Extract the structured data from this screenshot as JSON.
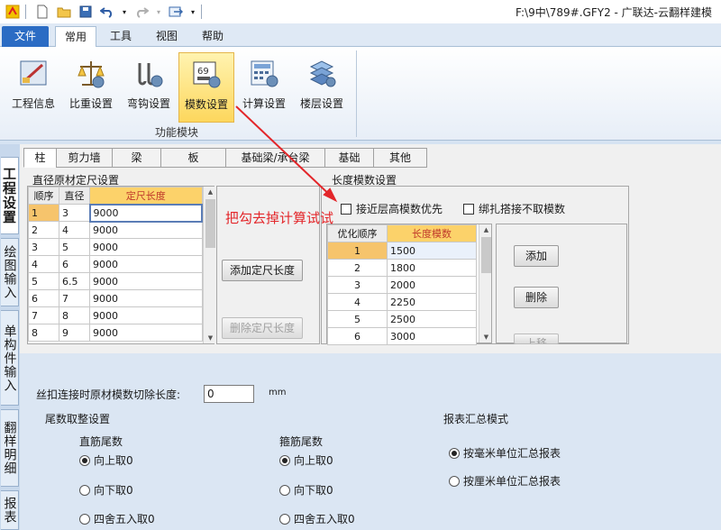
{
  "window": {
    "title": "F:\\9中\\789#.GFY2 - 广联达-云翻样建模"
  },
  "quick_access": [
    "new-file-icon",
    "open-folder-icon",
    "save-icon",
    "undo-icon",
    "redo-icon",
    "export-icon"
  ],
  "menu": {
    "file": "文件",
    "tabs": [
      "常用",
      "工具",
      "视图",
      "帮助"
    ],
    "active": "常用"
  },
  "ribbon": {
    "buttons": [
      {
        "label": "工程信息",
        "icon": "project-info-icon"
      },
      {
        "label": "比重设置",
        "icon": "scale-icon"
      },
      {
        "label": "弯钩设置",
        "icon": "hook-icon"
      },
      {
        "label": "模数设置",
        "icon": "modulus-icon"
      },
      {
        "label": "计算设置",
        "icon": "calculator-icon"
      },
      {
        "label": "楼层设置",
        "icon": "floor-icon"
      }
    ],
    "group_label": "功能模块"
  },
  "side_tabs": [
    "工程设置",
    "绘图输入",
    "单构件输入",
    "翻样明细",
    "报表"
  ],
  "sub_tabs": [
    "柱",
    "剪力墙",
    "梁",
    "板",
    "基础梁/承台梁",
    "基础",
    "其他"
  ],
  "diameter": {
    "title": "直径原材定尺设置",
    "headers": [
      "顺序",
      "直径",
      "定尺长度"
    ],
    "rows": [
      [
        "1",
        "3",
        "9000"
      ],
      [
        "2",
        "4",
        "9000"
      ],
      [
        "3",
        "5",
        "9000"
      ],
      [
        "4",
        "6",
        "9000"
      ],
      [
        "5",
        "6.5",
        "9000"
      ],
      [
        "6",
        "7",
        "9000"
      ],
      [
        "7",
        "8",
        "9000"
      ],
      [
        "8",
        "9",
        "9000"
      ]
    ],
    "add_button": "添加定尺长度",
    "delete_button": "删除定尺长度"
  },
  "length": {
    "title": "长度模数设置",
    "checkbox_near": "接近层高模数优先",
    "checkbox_lap": "绑扎搭接不取模数",
    "headers": [
      "优化顺序",
      "长度模数"
    ],
    "rows": [
      [
        "1",
        "1500"
      ],
      [
        "2",
        "1800"
      ],
      [
        "3",
        "2000"
      ],
      [
        "4",
        "2250"
      ],
      [
        "5",
        "2500"
      ],
      [
        "6",
        "3000"
      ]
    ],
    "add_button": "添加",
    "delete_button": "删除",
    "up_button": "上移"
  },
  "annotation": "把勾去掉计算试试",
  "bottom": {
    "cut_label": "丝扣连接时原材模数切除长度:",
    "cut_value": "0",
    "cut_unit": "mm",
    "tail_title": "尾数取整设置",
    "straight_title": "直筋尾数",
    "stirrup_title": "箍筋尾数",
    "options": [
      "向上取0",
      "向下取0",
      "四舍五入取0"
    ],
    "report_title": "报表汇总模式",
    "report_options": [
      "按毫米单位汇总报表",
      "按厘米单位汇总报表"
    ]
  },
  "colors": {
    "accent": "#2b6cc4",
    "selected": "#fdd75d",
    "annotation": "#e3262a"
  }
}
